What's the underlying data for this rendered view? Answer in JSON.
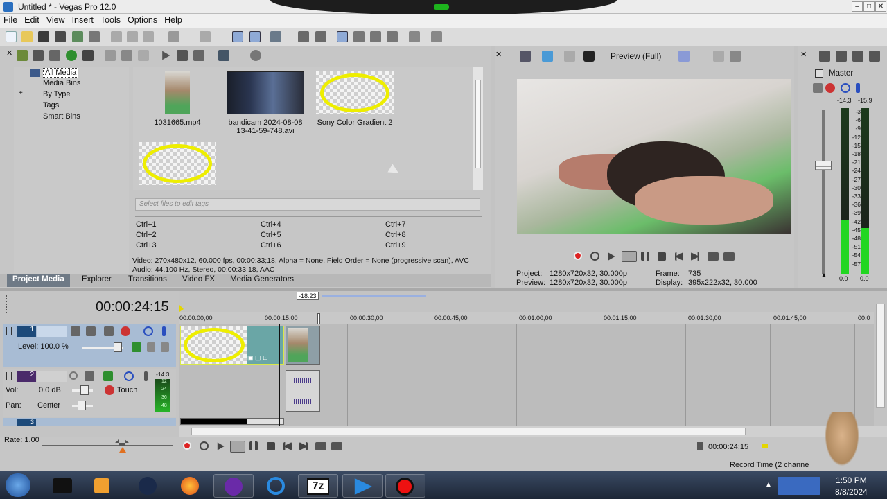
{
  "window": {
    "title": "Untitled * - Vegas Pro 12.0",
    "min": "–",
    "max": "□",
    "close": "✕"
  },
  "menu": [
    "File",
    "Edit",
    "View",
    "Insert",
    "Tools",
    "Options",
    "Help"
  ],
  "tree": {
    "items": [
      "All Media",
      "Media Bins",
      "By Type",
      "Tags",
      "Smart Bins"
    ],
    "expand": "+"
  },
  "media": {
    "items": [
      {
        "label": "1031665.mp4"
      },
      {
        "label": "bandicam 2024-08-08 13-41-59-748.avi"
      },
      {
        "label": "Sony Color Gradient 2"
      },
      {
        "label": ""
      }
    ],
    "tag_placeholder": "Select files to edit tags",
    "shortcuts": [
      "Ctrl+1",
      "Ctrl+4",
      "Ctrl+7",
      "Ctrl+2",
      "Ctrl+5",
      "Ctrl+8",
      "Ctrl+3",
      "Ctrl+6",
      "Ctrl+9"
    ],
    "info_video": "Video: 270x480x12, 60.000 fps, 00:00:33;18, Alpha = None, Field Order = None (progressive scan), AVC",
    "info_audio": "Audio: 44,100 Hz, Stereo, 00:00:33;18, AAC"
  },
  "tabs": [
    "Project Media",
    "Explorer",
    "Transitions",
    "Video FX",
    "Media Generators"
  ],
  "preview": {
    "mode": "Preview (Full)",
    "project_label": "Project:",
    "project_val": "1280x720x32, 30.000p",
    "preview_label": "Preview:",
    "preview_val": "1280x720x32, 30.000p",
    "frame_label": "Frame:",
    "frame_val": "735",
    "display_label": "Display:",
    "display_val": "395x222x32, 30.000"
  },
  "master": {
    "title": "Master",
    "peak_l": "-14.3",
    "peak_r": "-15.9",
    "scale": [
      "3",
      "6",
      "9",
      "12",
      "15",
      "18",
      "21",
      "24",
      "27",
      "30",
      "33",
      "36",
      "39",
      "42",
      "45",
      "48",
      "51",
      "54",
      "57"
    ],
    "bottom_l": "0.0",
    "bottom_r": "0.0",
    "level_l": 0.33,
    "level_r": 0.28
  },
  "timeline": {
    "time": "00:00:24:15",
    "marker": "-18:23",
    "ruler": [
      "00:00:00;00",
      "00:00:15;00",
      "00:00:30;00",
      "00:00:45;00",
      "00:01:00;00",
      "00:01:15;00",
      "00:01:30;00",
      "00:01:45;00",
      "00:0"
    ],
    "track1": {
      "num": "1",
      "level": "Level: 100.0 %"
    },
    "track2": {
      "num": "2",
      "vol_label": "Vol:",
      "vol": "0.0 dB",
      "pan_label": "Pan:",
      "pan": "Center",
      "mode": "Touch",
      "meter_top": "-14.3",
      "meter_nums": [
        "12",
        "24",
        "36",
        "48"
      ]
    },
    "track3": {
      "num": "3"
    },
    "rate": "Rate: 1.00",
    "transport_time": "00:00:24:15",
    "record_time": "Record Time (2 channe"
  },
  "taskbar": {
    "time": "1:50 PM",
    "date": "8/8/2024",
    "app_7z": "7z"
  },
  "colors": {
    "accent": "#2a6fbf",
    "meter": "#22d622",
    "ring": "#eeee00",
    "track1": "#9bb3cc",
    "track2": "#b7a6cf"
  }
}
